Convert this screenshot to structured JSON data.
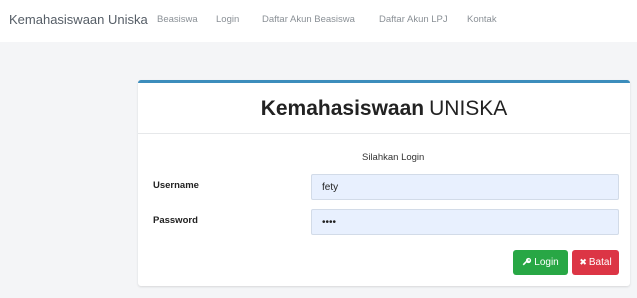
{
  "navbar": {
    "brand": "Kemahasiswaan Uniska",
    "links": [
      "Beasiswa",
      "Login",
      "Daftar Akun Beasiswa",
      "Daftar Akun LPJ",
      "Kontak"
    ]
  },
  "login_card": {
    "title_bold": "Kemahasiswaan",
    "title_light": "UNISKA",
    "subtitle": "Silahkan Login",
    "username_label": "Username",
    "username_value": "fety",
    "password_label": "Password",
    "password_value": "fety",
    "login_button": "Login",
    "cancel_button": "Batal"
  },
  "icons": {
    "login_button_icon": "key-icon",
    "cancel_button_icon": "times-icon"
  },
  "colors": {
    "card_accent": "#3c8dbc",
    "login_button": "#28a745",
    "cancel_button": "#dc3545",
    "input_background": "#e8f0fe"
  }
}
